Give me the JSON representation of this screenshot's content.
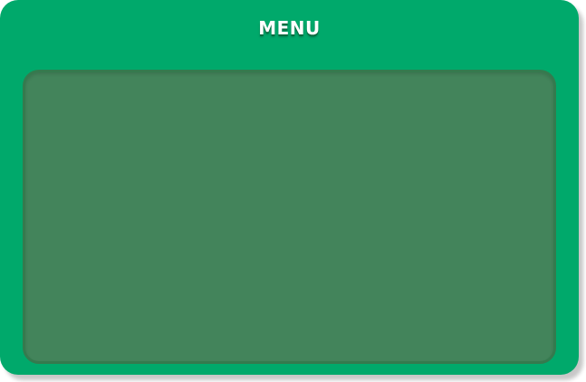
{
  "menu": {
    "title": "MENU"
  },
  "colors": {
    "panel": "#00a96b",
    "content_area": "#43845b",
    "content_border": "#357a4e",
    "title_text": "#ffffff",
    "title_shadow": "#0b6a3f"
  }
}
